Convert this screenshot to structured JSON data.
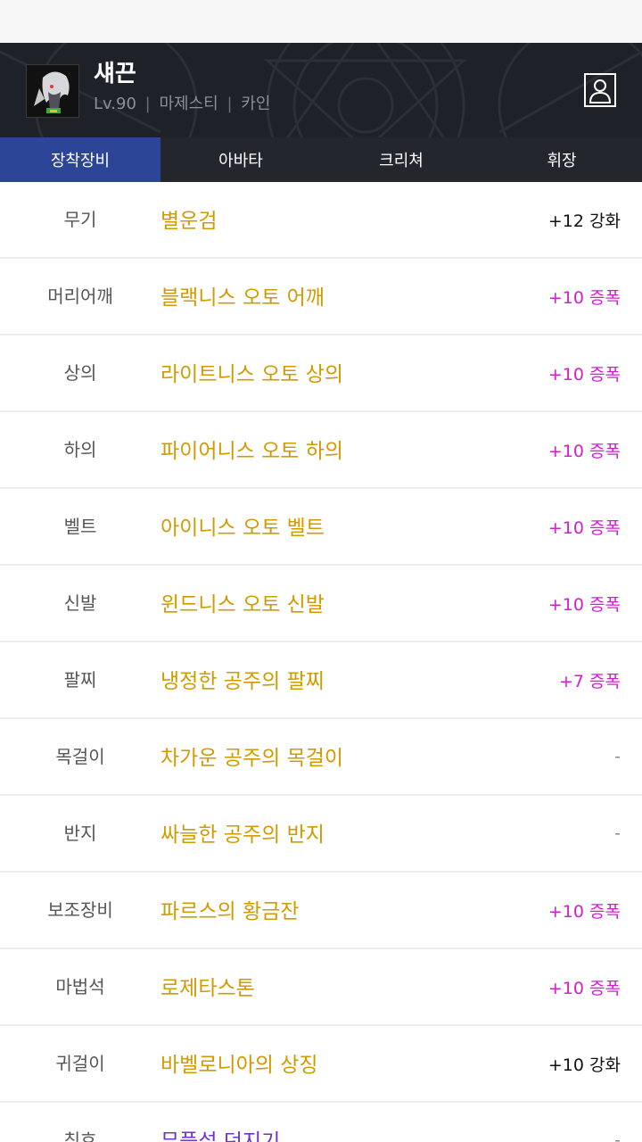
{
  "character": {
    "name": "섀끈",
    "level": "Lv.90",
    "job": "마제스티",
    "server": "카인",
    "separator": "|"
  },
  "tabs": [
    {
      "label": "장착장비",
      "active": true
    },
    {
      "label": "아바타",
      "active": false
    },
    {
      "label": "크리쳐",
      "active": false
    },
    {
      "label": "휘장",
      "active": false
    }
  ],
  "equipment": [
    {
      "slot": "무기",
      "item": "별운검",
      "enhance": "+12 강화",
      "type": "reinforce"
    },
    {
      "slot": "머리어깨",
      "item": "블랙니스 오토 어깨",
      "enhance": "+10 증폭",
      "type": "amplify"
    },
    {
      "slot": "상의",
      "item": "라이트니스 오토 상의",
      "enhance": "+10 증폭",
      "type": "amplify"
    },
    {
      "slot": "하의",
      "item": "파이어니스 오토 하의",
      "enhance": "+10 증폭",
      "type": "amplify"
    },
    {
      "slot": "벨트",
      "item": "아이니스 오토 벨트",
      "enhance": "+10 증폭",
      "type": "amplify"
    },
    {
      "slot": "신발",
      "item": "윈드니스 오토 신발",
      "enhance": "+10 증폭",
      "type": "amplify"
    },
    {
      "slot": "팔찌",
      "item": "냉정한 공주의 팔찌",
      "enhance": "+7 증폭",
      "type": "amplify"
    },
    {
      "slot": "목걸이",
      "item": "차가운 공주의 목걸이",
      "enhance": "-",
      "type": "none"
    },
    {
      "slot": "반지",
      "item": "싸늘한 공주의 반지",
      "enhance": "-",
      "type": "none"
    },
    {
      "slot": "보조장비",
      "item": "파르스의 황금잔",
      "enhance": "+10 증폭",
      "type": "amplify"
    },
    {
      "slot": "마법석",
      "item": "로제타스톤",
      "enhance": "+10 증폭",
      "type": "amplify"
    },
    {
      "slot": "귀걸이",
      "item": "바벨로니아의 상징",
      "enhance": "+10 강화",
      "type": "reinforce"
    },
    {
      "slot": "칭호",
      "item": "무플설 던지기",
      "enhance": "-",
      "type": "none",
      "rarity": "purple"
    }
  ],
  "colors": {
    "header_bg": "#1f2128",
    "tab_active": "#2d4596",
    "item_gold": "#d19a00",
    "item_purple": "#6f33c8",
    "amplify": "#d21ed0"
  },
  "icons": {
    "profile": "person-icon",
    "avatar": "character-portrait"
  }
}
